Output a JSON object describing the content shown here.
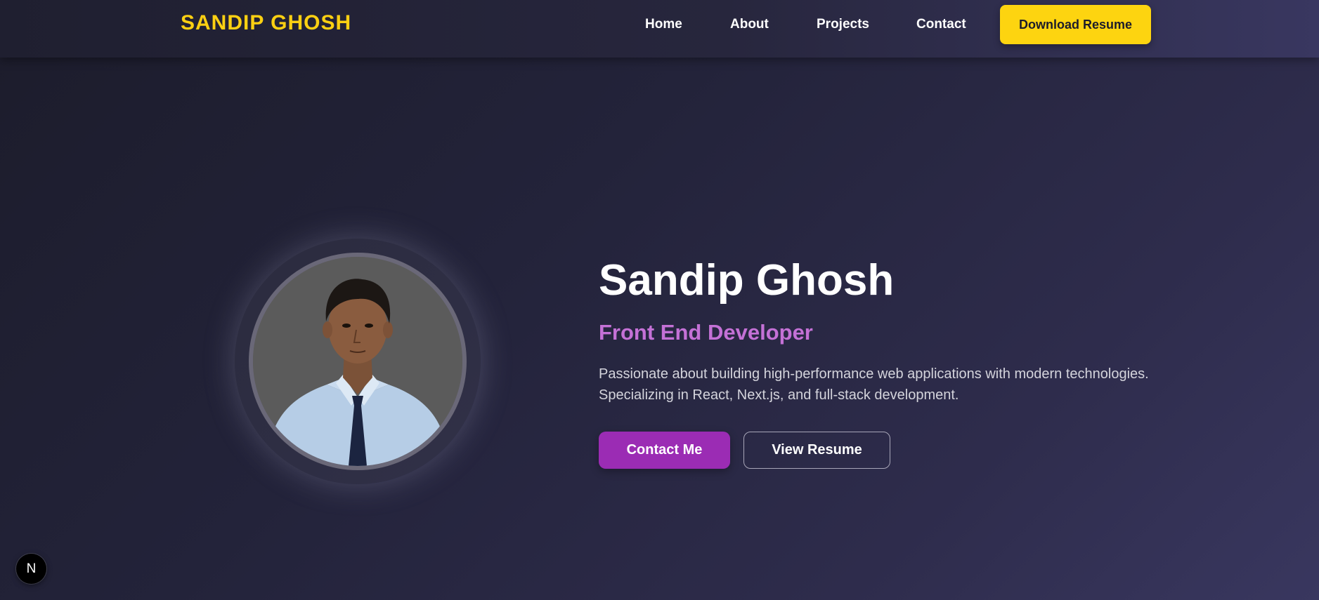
{
  "brand": {
    "logo_text": "SANDIP GHOSH",
    "accent": "#fcd012"
  },
  "nav": {
    "links": [
      {
        "label": "Home"
      },
      {
        "label": "About"
      },
      {
        "label": "Projects"
      },
      {
        "label": "Contact"
      }
    ],
    "download_label": "Download Resume"
  },
  "hero": {
    "name": "Sandip Ghosh",
    "role": "Front End Developer",
    "description_line1": "Passionate about building high-performance web applications with modern technologies.",
    "description_line2": "Specializing in React, Next.js, and full-stack development.",
    "contact_label": "Contact Me",
    "resume_label": "View Resume",
    "avatar_icon": "profile-photo",
    "role_color": "#c471d6",
    "primary_button_color": "#9b2cb4"
  },
  "dev_badge": {
    "letter": "N",
    "icon": "nextjs-icon"
  }
}
